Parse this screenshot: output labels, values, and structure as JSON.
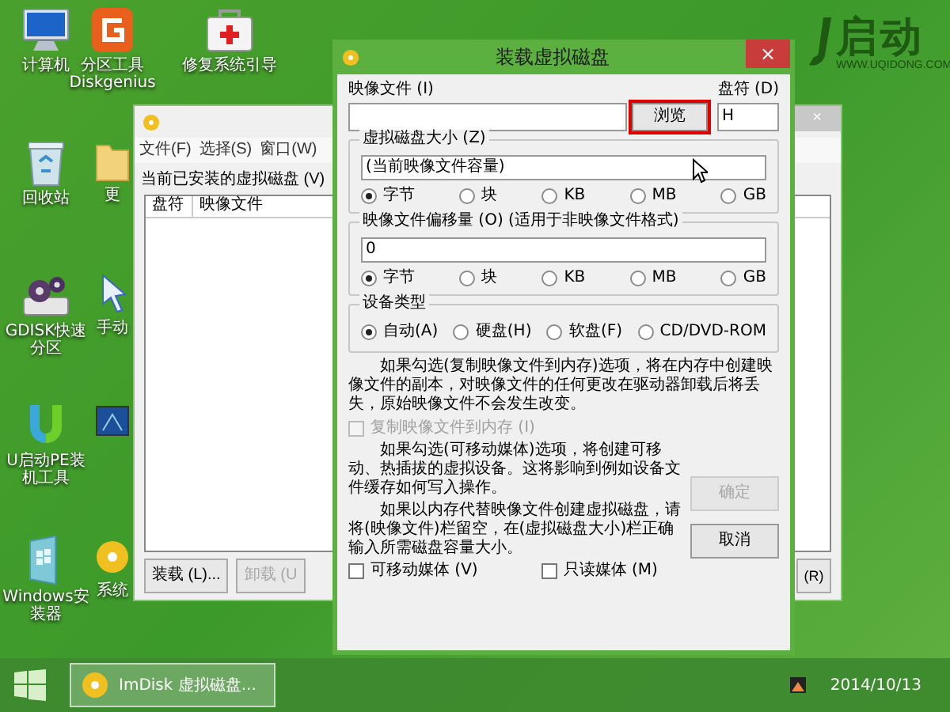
{
  "desktop": {
    "columns": [
      [
        {
          "kind": "computer",
          "label": "计算机"
        },
        {
          "kind": "recycle",
          "label": "回收站"
        },
        {
          "kind": "gdisk",
          "label": "GDISK快速分区"
        },
        {
          "kind": "ulogo",
          "label": "U启动PE装机工具"
        },
        {
          "kind": "installer",
          "label": "Windows安装器"
        }
      ],
      [
        {
          "kind": "diskgenius",
          "label": "分区工具 Diskgenius"
        },
        {
          "kind": "folder",
          "label": "更"
        },
        {
          "kind": "hand",
          "label": "手动"
        },
        {
          "kind": "monitor"
        },
        {
          "kind": "disc",
          "label": "系统"
        }
      ],
      [
        {
          "kind": "toolbox",
          "label": "修复系统引导"
        }
      ]
    ],
    "wallpaper_logo": {
      "name": "启动",
      "url": "WWW.UQIDONG.COM"
    }
  },
  "background_window": {
    "menu": [
      "文件(F)",
      "选择(S)",
      "窗口(W)"
    ],
    "list_label": "当前已安装的虚拟磁盘 (V)",
    "columns": [
      "盘符",
      "映像文件"
    ],
    "close_glyph": "×",
    "buttons": [
      {
        "label": "装载 (L)...",
        "disabled": false
      },
      {
        "label": "卸载 (U",
        "disabled": true
      }
    ],
    "right_button": "(R)"
  },
  "dialog": {
    "title": "装载虚拟磁盘",
    "close_glyph": "×",
    "image_file_label": "映像文件 (I)",
    "drive_label": "盘符 (D)",
    "browse_button": {
      "label": "浏览",
      "highlighted": true
    },
    "drive_value": "H",
    "size_group": {
      "legend": "虚拟磁盘大小 (Z)",
      "value": "(当前映像文件容量)",
      "units": [
        {
          "label": "字节",
          "selected": true
        },
        {
          "label": "块",
          "selected": false
        },
        {
          "label": "KB",
          "selected": false
        },
        {
          "label": "MB",
          "selected": false
        },
        {
          "label": "GB",
          "selected": false
        }
      ]
    },
    "offset_group": {
      "legend": "映像文件偏移量 (O) (适用于非映像文件格式)",
      "value": "0",
      "units": [
        {
          "label": "字节",
          "selected": true
        },
        {
          "label": "块",
          "selected": false
        },
        {
          "label": "KB",
          "selected": false
        },
        {
          "label": "MB",
          "selected": false
        },
        {
          "label": "GB",
          "selected": false
        }
      ]
    },
    "device_group": {
      "legend": "设备类型",
      "types": [
        {
          "label": "自动(A)",
          "selected": true
        },
        {
          "label": "硬盘(H)",
          "selected": false
        },
        {
          "label": "软盘(F)",
          "selected": false
        },
        {
          "label": "CD/DVD-ROM",
          "selected": false
        }
      ]
    },
    "note_copy": "如果勾选(复制映像文件到内存)选项，将在内存中创建映像文件的副本，对映像文件的任何更改在驱动器卸载后将丢失，原始映像文件不会发生改变。",
    "copy_checkbox": {
      "label": "复制映像文件到内存 (I)",
      "checked": false,
      "disabled": true
    },
    "note_removable": "如果勾选(可移动媒体)选项，将创建可移动、热插拔的虚拟设备。这将影响到例如设备文件缓存如何写入操作。",
    "note_memory": "如果以内存代替映像文件创建虚拟磁盘，请将(映像文件)栏留空，在(虚拟磁盘大小)栏正确输入所需磁盘容量大小。",
    "ok_button": {
      "label": "确定",
      "disabled": true
    },
    "cancel_button": {
      "label": "取消",
      "disabled": false
    },
    "options": [
      {
        "label": "可移动媒体 (V)",
        "checked": false,
        "disabled": false
      },
      {
        "label": "只读媒体 (M)",
        "checked": false,
        "disabled": false
      }
    ]
  },
  "taskbar": {
    "tasks": [
      {
        "label": "ImDisk 虚拟磁盘...",
        "selected": true
      }
    ],
    "date": "2014/10/13"
  }
}
